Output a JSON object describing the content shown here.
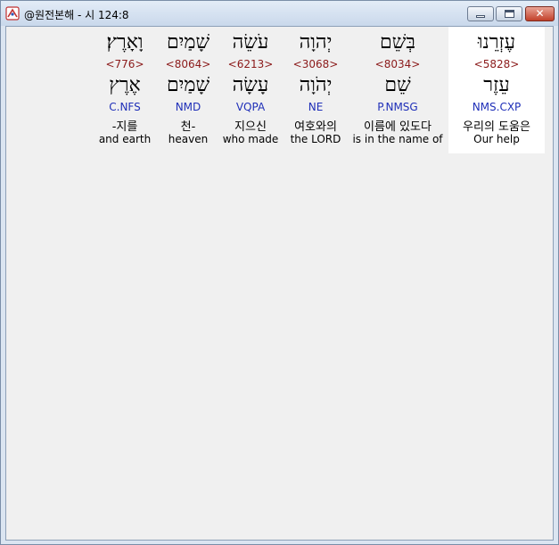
{
  "window": {
    "title": "@원전본해 - 시 124:8",
    "buttons": {
      "minimize": "minimize",
      "maximize": "maximize",
      "close": "✕"
    }
  },
  "words": [
    {
      "heb1": "עֶזְרֵנוּ",
      "strong": "<5828>",
      "heb2": "עֵזֶר",
      "morph": "NMS.CXP",
      "korean": "우리의 도움은",
      "english": "Our help",
      "selected": true
    },
    {
      "heb1": "בְּשֵׁם",
      "strong": "<8034>",
      "heb2": "שֵׁם",
      "morph": "P.NMSG",
      "korean": "이름에 있도다",
      "english": "is in the name of",
      "selected": false
    },
    {
      "heb1": "יְהוָה",
      "strong": "<3068>",
      "heb2": "יְהֹוָה",
      "morph": "NE",
      "korean": "여호와의",
      "english": "the LORD",
      "selected": false
    },
    {
      "heb1": "עֹשֵׂה",
      "strong": "<6213>",
      "heb2": "עָשָׂה",
      "morph": "VQPA",
      "korean": "지으신",
      "english": "who made",
      "selected": false
    },
    {
      "heb1": "שָׁמַיִם",
      "strong": "<8064>",
      "heb2": "שָׁמַיִם",
      "morph": "NMD",
      "korean": "천-",
      "english": "heaven",
      "selected": false
    },
    {
      "heb1": "וָאָרֶץ׃",
      "strong": "<776>",
      "heb2": "אֶרֶץ",
      "morph": "C.NFS",
      "korean": "-지를",
      "english": "and earth",
      "selected": false
    }
  ],
  "colors": {
    "strong": "#8b1a1a",
    "morph": "#1f2fb8",
    "selected_bg": "#ffffff"
  }
}
